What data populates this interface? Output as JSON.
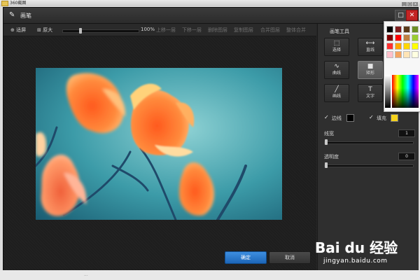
{
  "outer": {
    "title": "360截图"
  },
  "window": {
    "title": "画笔",
    "min_glyph": "□",
    "close_glyph": "✕"
  },
  "toolbar": {
    "fit_label": "适屏",
    "orig_label": "原大",
    "zoom": "100%",
    "zoom_fraction": 0.22,
    "prev": "上移一层",
    "next": "下移一层",
    "delete": "删除图层",
    "copy": "复制图层",
    "merge": "合并图层",
    "merge_all": "整体合并"
  },
  "panel": {
    "title": "画笔工具",
    "tools": [
      {
        "label": "选择",
        "icon": "select-icon"
      },
      {
        "label": "直线",
        "icon": "line-icon"
      },
      {
        "label": "曲线",
        "icon": "curve-icon"
      },
      {
        "label": "矩形",
        "icon": "rectangle-icon",
        "active": true
      },
      {
        "label": "画线",
        "icon": "pencil-icon"
      },
      {
        "label": "文字",
        "icon": "text-icon"
      }
    ],
    "border_label": "边线",
    "fill_label": "填充",
    "border_color": "#000000",
    "fill_color": "#f5d21c",
    "line_width_label": "线宽",
    "line_width_value": "1",
    "line_width_fraction": 0.0,
    "opacity_label": "透明度",
    "opacity_value": "0",
    "opacity_fraction": 0.0
  },
  "palette": {
    "colors": [
      "#000000",
      "#7f1f1f",
      "#5a3a1a",
      "#6b8e23",
      "#7f0000",
      "#ff0000",
      "#c08040",
      "#9acd32",
      "#ff3030",
      "#ffa500",
      "#ffd700",
      "#ffff00",
      "#ffc0cb",
      "#f4a460",
      "#ffe4b5",
      "#ffffe0"
    ]
  },
  "footer": {
    "confirm": "确定",
    "cancel": "取消"
  },
  "watermark": {
    "logo": "Bai du 经验",
    "sub": "jingyan.baidu.com"
  },
  "status": {
    "text": "..."
  }
}
